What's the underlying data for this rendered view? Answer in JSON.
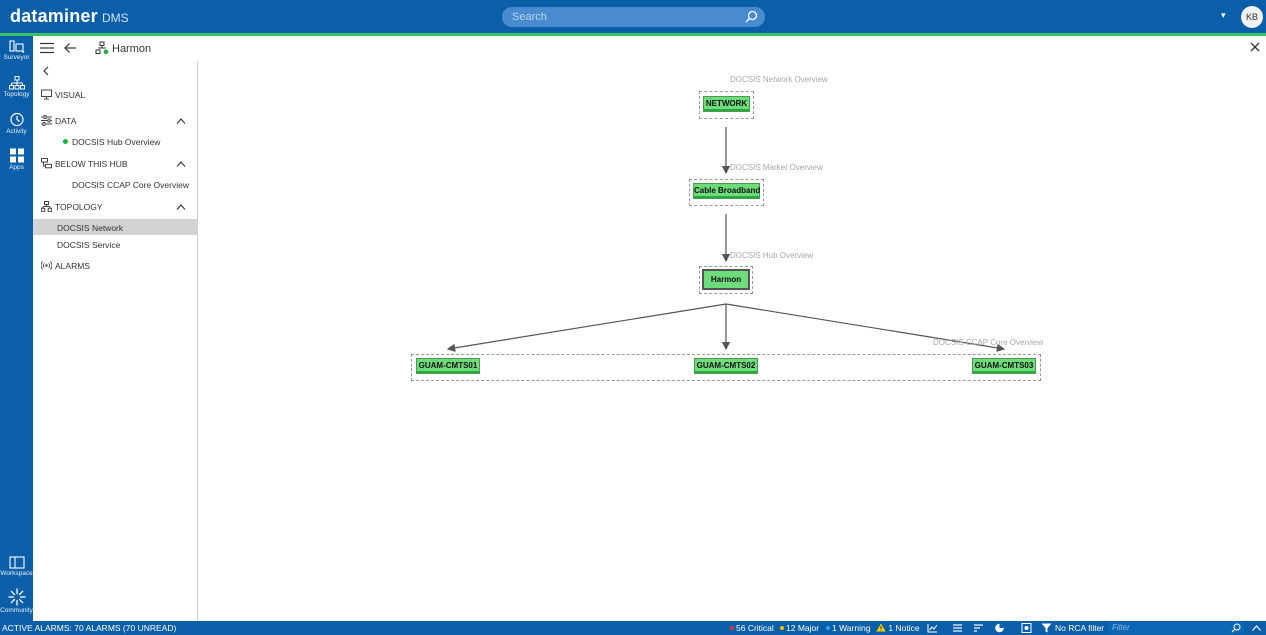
{
  "header": {
    "brand": "dataminer",
    "brand_sub": "DMS",
    "search_placeholder": "Search",
    "user_initials": "KB",
    "menu_caret": "▾"
  },
  "rail": [
    {
      "label": "Surveyor",
      "icon": "surveyor-icon"
    },
    {
      "label": "Topology",
      "icon": "topology-icon"
    },
    {
      "label": "Activity",
      "icon": "activity-icon"
    },
    {
      "label": "Apps",
      "icon": "apps-icon"
    },
    {
      "label": "Workspace",
      "icon": "workspace-icon"
    },
    {
      "label": "Community",
      "icon": "community-icon"
    }
  ],
  "toolbar": {
    "breadcrumb": "Harmon"
  },
  "panel": {
    "visual": "VISUAL",
    "data": {
      "label": "DATA",
      "items": [
        "DOCSIS Hub Overview"
      ]
    },
    "below": {
      "label": "BELOW THIS HUB",
      "items": [
        "DOCSIS CCAP Core Overview"
      ]
    },
    "topology": {
      "label": "TOPOLOGY",
      "items": [
        "DOCSIS Network",
        "DOCSIS Service"
      ]
    },
    "alarms": "ALARMS"
  },
  "topology": {
    "levels": [
      {
        "view": "DOCSIS Network Overview",
        "nodes": [
          "NETWORK"
        ]
      },
      {
        "view": "DOCSIS Market Overview",
        "nodes": [
          "Cable Broadband"
        ]
      },
      {
        "view": "DOCSIS Hub Overview",
        "nodes": [
          "Harmon"
        ]
      },
      {
        "view": "DOCSIS CCAP Core Overview",
        "nodes": [
          "GUAM-CMTS01",
          "GUAM-CMTS02",
          "GUAM-CMTS03"
        ]
      }
    ],
    "selected": "Harmon",
    "colors": {
      "node_fill": "#6edc7a",
      "node_border": "#4a9a52",
      "node_bar": "#29a83c"
    }
  },
  "status": {
    "active_alarms": "ACTIVE ALARMS: 70 ALARMS (70 UNREAD)",
    "critical": "56 Critical",
    "major": "12 Major",
    "warning": "1 Warning",
    "notice": "1 Notice",
    "rca": "No RCA filter",
    "filter_placeholder": "Filter",
    "colors": {
      "critical": "#e8323c",
      "major": "#ffc000",
      "warning": "#2ea8ff",
      "notice": "#ffd400"
    }
  }
}
